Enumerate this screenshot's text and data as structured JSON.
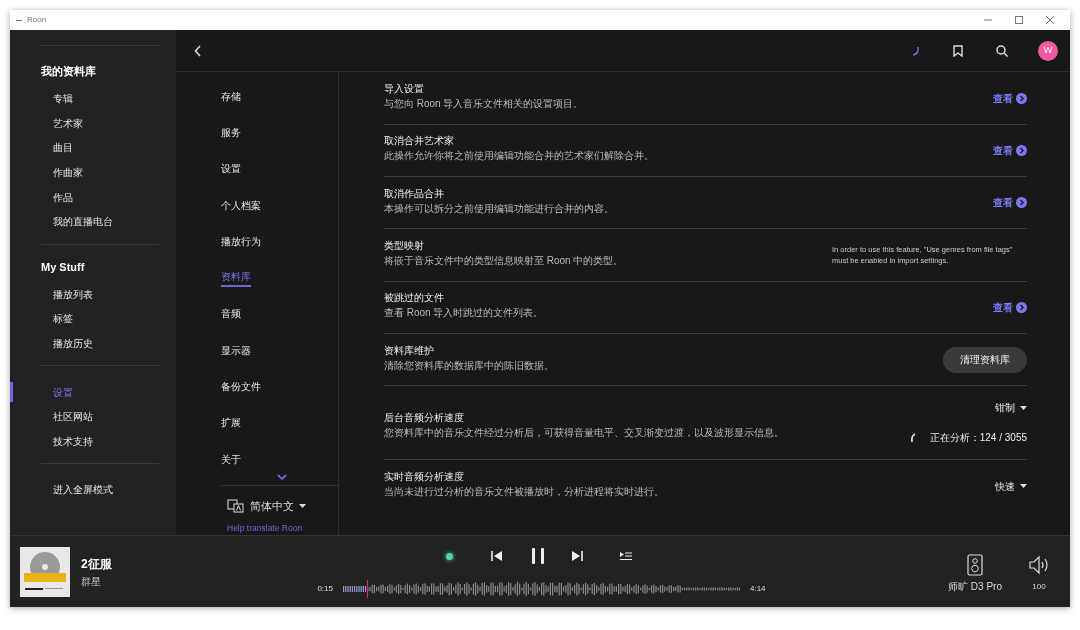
{
  "window": {
    "title": "Roon"
  },
  "sidebar": {
    "sections": [
      {
        "heading": "我的资料库",
        "items": [
          {
            "label": "专辑",
            "selected": false
          },
          {
            "label": "艺术家",
            "selected": false
          },
          {
            "label": "曲目",
            "selected": false
          },
          {
            "label": "作曲家",
            "selected": false
          },
          {
            "label": "作品",
            "selected": false
          },
          {
            "label": "我的直播电台",
            "selected": false
          }
        ]
      },
      {
        "heading": "My Stuff",
        "items": [
          {
            "label": "播放列表",
            "selected": false
          },
          {
            "label": "标签",
            "selected": false
          },
          {
            "label": "播放历史",
            "selected": false
          }
        ]
      },
      {
        "items": [
          {
            "label": "设置",
            "selected": true
          },
          {
            "label": "社区网站",
            "selected": false
          },
          {
            "label": "技术支持",
            "selected": false
          }
        ]
      },
      {
        "items": [
          {
            "label": "进入全屏模式",
            "selected": false
          }
        ]
      }
    ]
  },
  "topbar": {
    "avatar": "W"
  },
  "settings_nav": {
    "items": [
      {
        "label": "存储",
        "selected": false
      },
      {
        "label": "服务",
        "selected": false
      },
      {
        "label": "设置",
        "selected": false
      },
      {
        "label": "个人档案",
        "selected": false
      },
      {
        "label": "播放行为",
        "selected": false
      },
      {
        "label": "资料库",
        "selected": true
      },
      {
        "label": "音频",
        "selected": false
      },
      {
        "label": "显示器",
        "selected": false
      },
      {
        "label": "备份文件",
        "selected": false
      },
      {
        "label": "扩展",
        "selected": false
      },
      {
        "label": "关于",
        "selected": false
      }
    ],
    "language": "简体中文",
    "help_link": "Help translate Roon"
  },
  "settings_rows": [
    {
      "title": "导入设置",
      "description": "与您向 Roon 导入音乐文件相关的设置项目。",
      "kind": "link",
      "action": "查看"
    },
    {
      "title": "取消合并艺术家",
      "description": "此操作允许你将之前使用编辑功能合并的艺术家们解除合并。",
      "kind": "link",
      "action": "查看"
    },
    {
      "title": "取消作品合并",
      "description": "本操作可以拆分之前使用编辑功能进行合并的内容。",
      "kind": "link",
      "action": "查看"
    },
    {
      "title": "类型映射",
      "description": "将嵌于音乐文件中的类型信息映射至 Roon 中的类型。",
      "kind": "note",
      "note": "In order to use this feature, \"Use genres from file tags\" must be enabled in import settings."
    },
    {
      "title": "被跳过的文件",
      "description": "查看 Roon 导入时跳过的文件列表。",
      "kind": "link",
      "action": "查看"
    },
    {
      "title": "资料库维护",
      "description": "清除您资料库的数据库中的陈旧数据。",
      "kind": "button",
      "action": "清理资料库"
    },
    {
      "title": "后台音频分析速度",
      "description": "您资料库中的音乐文件经过分析后，可获得音量电平、交叉渐变过渡，以及波形显示信息。",
      "kind": "dropdown",
      "value": "钳制",
      "progress": "正在分析：124 / 3055"
    },
    {
      "title": "实时音频分析速度",
      "description": "当尚未进行过分析的音乐文件被播放时，分析进程将实时进行。",
      "kind": "dropdown",
      "value": "快速"
    }
  ],
  "player": {
    "track": "2征服",
    "artist": "群星",
    "elapsed": "0:15",
    "duration": "4:14",
    "level": 0.06,
    "zone": "师旷 D3 Pro",
    "volume": "100"
  }
}
